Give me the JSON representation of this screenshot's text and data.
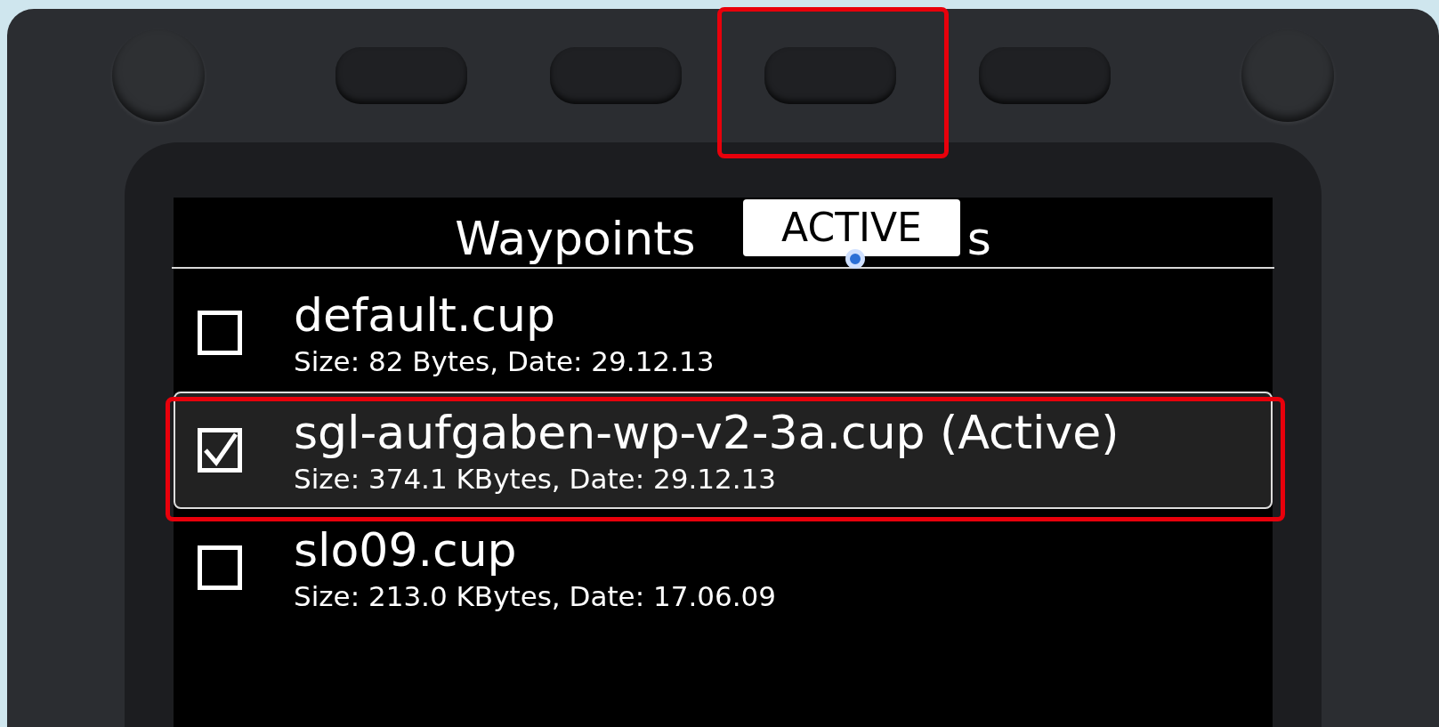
{
  "screen": {
    "title": "Waypoints",
    "title_tail": "s",
    "tooltip": "ACTIVE"
  },
  "files": [
    {
      "name": "default.cup",
      "details": "Size: 82 Bytes, Date: 29.12.13",
      "checked": false,
      "selected": false
    },
    {
      "name": "sgl-aufgaben-wp-v2-3a.cup (Active)",
      "details": "Size: 374.1 KBytes, Date: 29.12.13",
      "checked": true,
      "selected": true
    },
    {
      "name": "slo09.cup",
      "details": "Size: 213.0 KBytes, Date: 17.06.09",
      "checked": false,
      "selected": false
    }
  ]
}
